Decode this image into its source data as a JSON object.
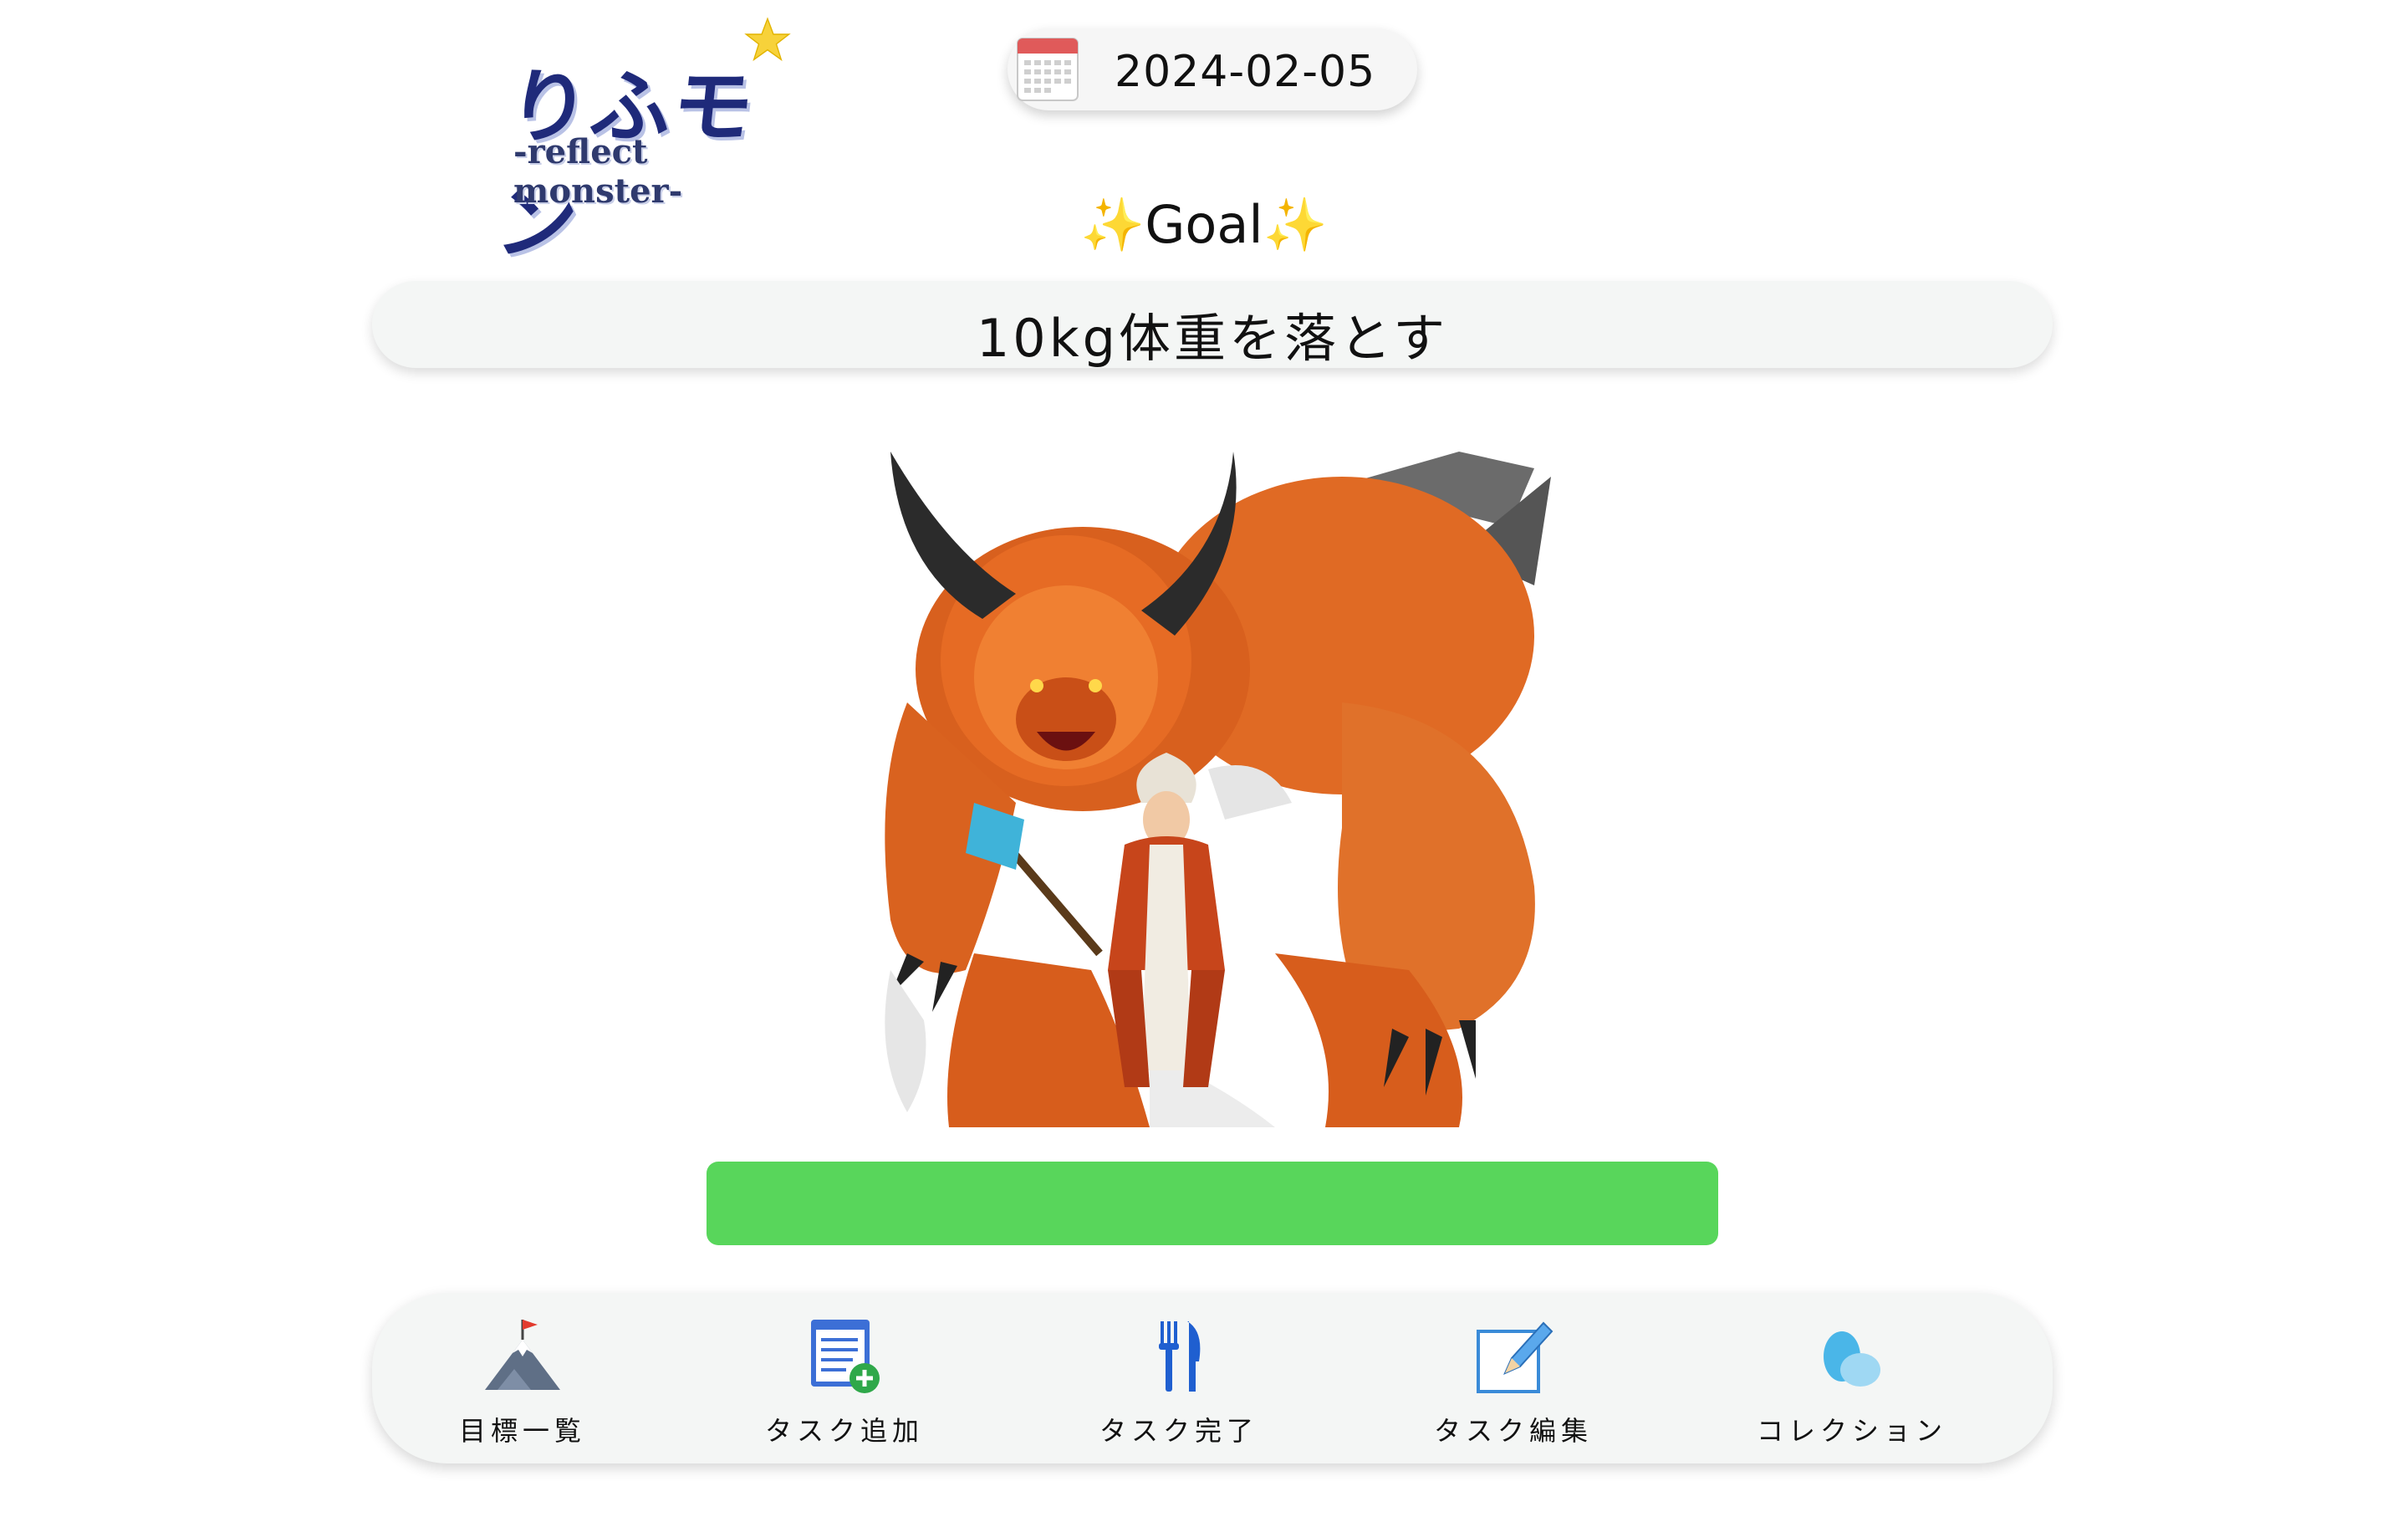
{
  "header": {
    "logo_title": "りふモン",
    "logo_subtitle": "-reflect monster-",
    "date": "2024-02-05"
  },
  "goal": {
    "heading": "Goal",
    "spark": "✨",
    "text": "10kg体重を落とす"
  },
  "monster": {
    "icon": "monster-illustration"
  },
  "hp_bar": {
    "fill_fraction": 1.0,
    "color": "#58d65b"
  },
  "nav": {
    "items": [
      {
        "label": "目標一覧",
        "icon": "mountain-flag-icon"
      },
      {
        "label": "タスク追加",
        "icon": "add-task-icon"
      },
      {
        "label": "タスク完了",
        "icon": "fork-knife-icon"
      },
      {
        "label": "タスク編集",
        "icon": "edit-pencil-icon"
      },
      {
        "label": "コレクション",
        "icon": "egg-collection-icon"
      }
    ]
  }
}
